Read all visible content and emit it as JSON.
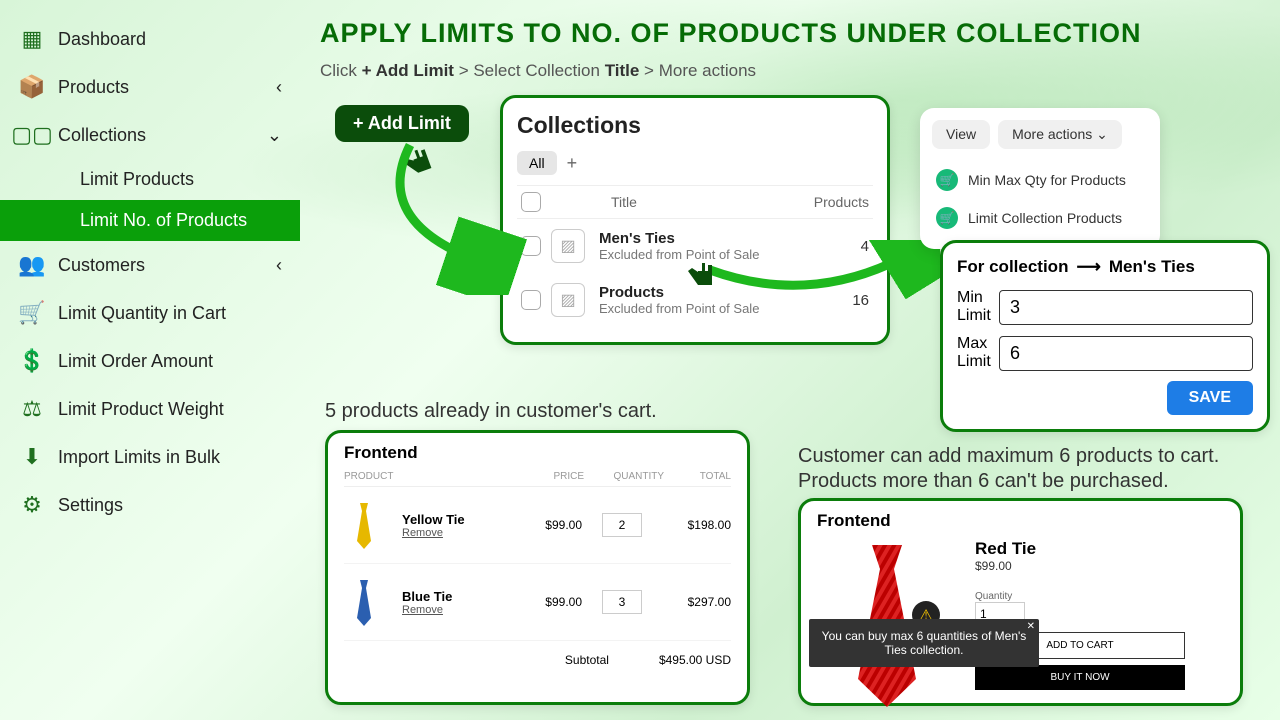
{
  "sidebar": {
    "items": [
      {
        "label": "Dashboard",
        "icon": "grid"
      },
      {
        "label": "Products",
        "icon": "box",
        "chev": "‹"
      },
      {
        "label": "Collections",
        "icon": "tiles",
        "chev": "⌄"
      },
      {
        "label": "Limit Products",
        "child": true
      },
      {
        "label": "Limit No. of Products",
        "child": true,
        "active": true
      },
      {
        "label": "Customers",
        "icon": "people",
        "chev": "‹"
      },
      {
        "label": "Limit Quantity in Cart",
        "icon": "cart"
      },
      {
        "label": "Limit Order Amount",
        "icon": "money"
      },
      {
        "label": "Limit Product Weight",
        "icon": "scale"
      },
      {
        "label": "Import Limits in Bulk",
        "icon": "download"
      },
      {
        "label": "Settings",
        "icon": "gear"
      }
    ]
  },
  "headline": "APPLY LIMITS TO NO. OF PRODUCTS UNDER COLLECTION",
  "instruction": {
    "prefix": "Click ",
    "b1": "+ Add Limit",
    " g1": " > Select Collection ",
    "b2": "Title",
    "g2": " > More actions"
  },
  "add_limit": "+ Add Limit",
  "collections": {
    "title": "Collections",
    "all": "All",
    "col_title": "Title",
    "col_products": "Products",
    "rows": [
      {
        "title": "Men's Ties",
        "sub": "Excluded from Point of Sale",
        "count": "4"
      },
      {
        "title": "Products",
        "sub": "Excluded from Point of Sale",
        "count": "16"
      }
    ]
  },
  "actions": {
    "view": "View",
    "more": "More actions",
    "items": [
      "Min Max Qty for Products",
      "Limit Collection Products"
    ]
  },
  "limit_form": {
    "for_label": "For collection",
    "target": "Men's Ties",
    "min_label": "Min Limit",
    "min": "3",
    "max_label": "Max Limit",
    "max": "6",
    "save": "SAVE"
  },
  "caption1": "5 products already in customer's cart.",
  "caption2a": "Customer can add maximum 6 products to cart.",
  "caption2b": "Products more than 6 can't be purchased.",
  "frontend": "Frontend",
  "cart": {
    "cols": {
      "product": "PRODUCT",
      "price": "PRICE",
      "qty": "QUANTITY",
      "total": "TOTAL"
    },
    "rows": [
      {
        "name": "Yellow Tie",
        "remove": "Remove",
        "price": "$99.00",
        "qty": "2",
        "total": "$198.00",
        "color": "#e6b800"
      },
      {
        "name": "Blue Tie",
        "remove": "Remove",
        "price": "$99.00",
        "qty": "3",
        "total": "$297.00",
        "color": "#2b5fb0"
      }
    ],
    "subtotal_label": "Subtotal",
    "subtotal": "$495.00 USD"
  },
  "product_page": {
    "name": "Red Tie",
    "price": "$99.00",
    "qty_label": "Quantity",
    "qty": "1",
    "add": "ADD TO CART",
    "buy": "BUY IT NOW",
    "toast": "You can buy max 6 quantities of Men's Ties collection."
  }
}
